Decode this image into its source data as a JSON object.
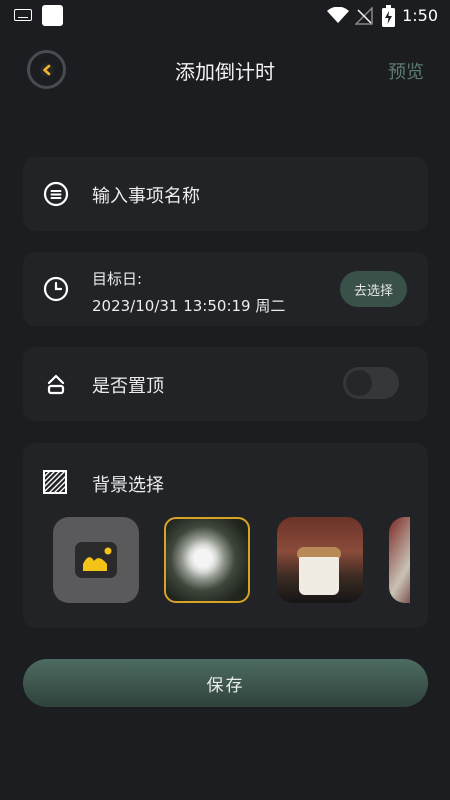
{
  "status_bar": {
    "time": "1:50"
  },
  "header": {
    "title": "添加倒计时",
    "preview": "预览"
  },
  "form": {
    "name_placeholder": "输入事项名称",
    "target_label": "目标日:",
    "target_value": "2023/10/31 13:50:19 周二",
    "choose_button": "去选择",
    "pin_label": "是否置顶",
    "pin_on": false,
    "background_label": "背景选择",
    "background_options": [
      "add-image",
      "dandelion",
      "coffee-cup",
      "partial-photo"
    ],
    "selected_background": "dandelion"
  },
  "footer": {
    "save_label": "保存"
  },
  "colors": {
    "background": "#1c1d21",
    "card": "#222327",
    "accent_green": "#3a5149",
    "selection_gold": "#d9a227",
    "back_arrow": "#f0b429"
  }
}
